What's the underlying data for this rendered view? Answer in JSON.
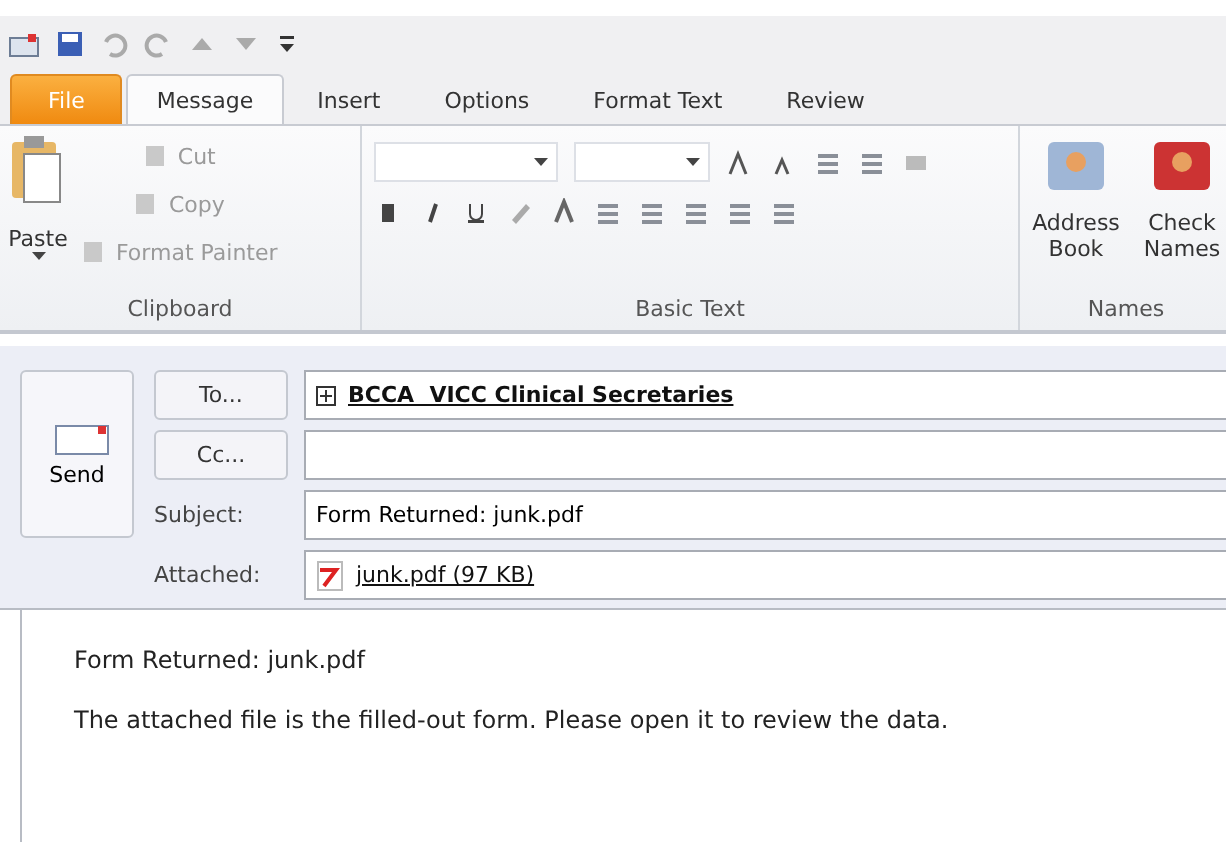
{
  "tabs": [
    {
      "label": "File",
      "kind": "file",
      "selected": false
    },
    {
      "label": "Message",
      "kind": "tab",
      "selected": true
    },
    {
      "label": "Insert",
      "kind": "tab",
      "selected": false
    },
    {
      "label": "Options",
      "kind": "tab",
      "selected": false
    },
    {
      "label": "Format Text",
      "kind": "tab",
      "selected": false
    },
    {
      "label": "Review",
      "kind": "tab",
      "selected": false
    }
  ],
  "clipboard": {
    "title": "Clipboard",
    "paste": "Paste",
    "items": [
      {
        "label": "Cut",
        "disabled": true
      },
      {
        "label": "Copy",
        "disabled": true
      },
      {
        "label": "Format Painter",
        "disabled": true
      }
    ]
  },
  "basic_text": {
    "title": "Basic Text"
  },
  "names": {
    "title": "Names",
    "buttons": [
      {
        "label": "Address Book"
      },
      {
        "label": "Check Names"
      }
    ]
  },
  "compose": {
    "send": "Send",
    "to_button": "To...",
    "cc_button": "Cc...",
    "to_value": "BCCA  VICC Clinical Secretaries",
    "subject_label": "Subject:",
    "subject": "Form Returned: junk.pdf",
    "attached_label": "Attached:",
    "attachment": "junk.pdf (97 KB)"
  },
  "body": [
    "Form Returned: junk.pdf",
    "The attached file is the filled-out form. Please open it to review the data."
  ]
}
